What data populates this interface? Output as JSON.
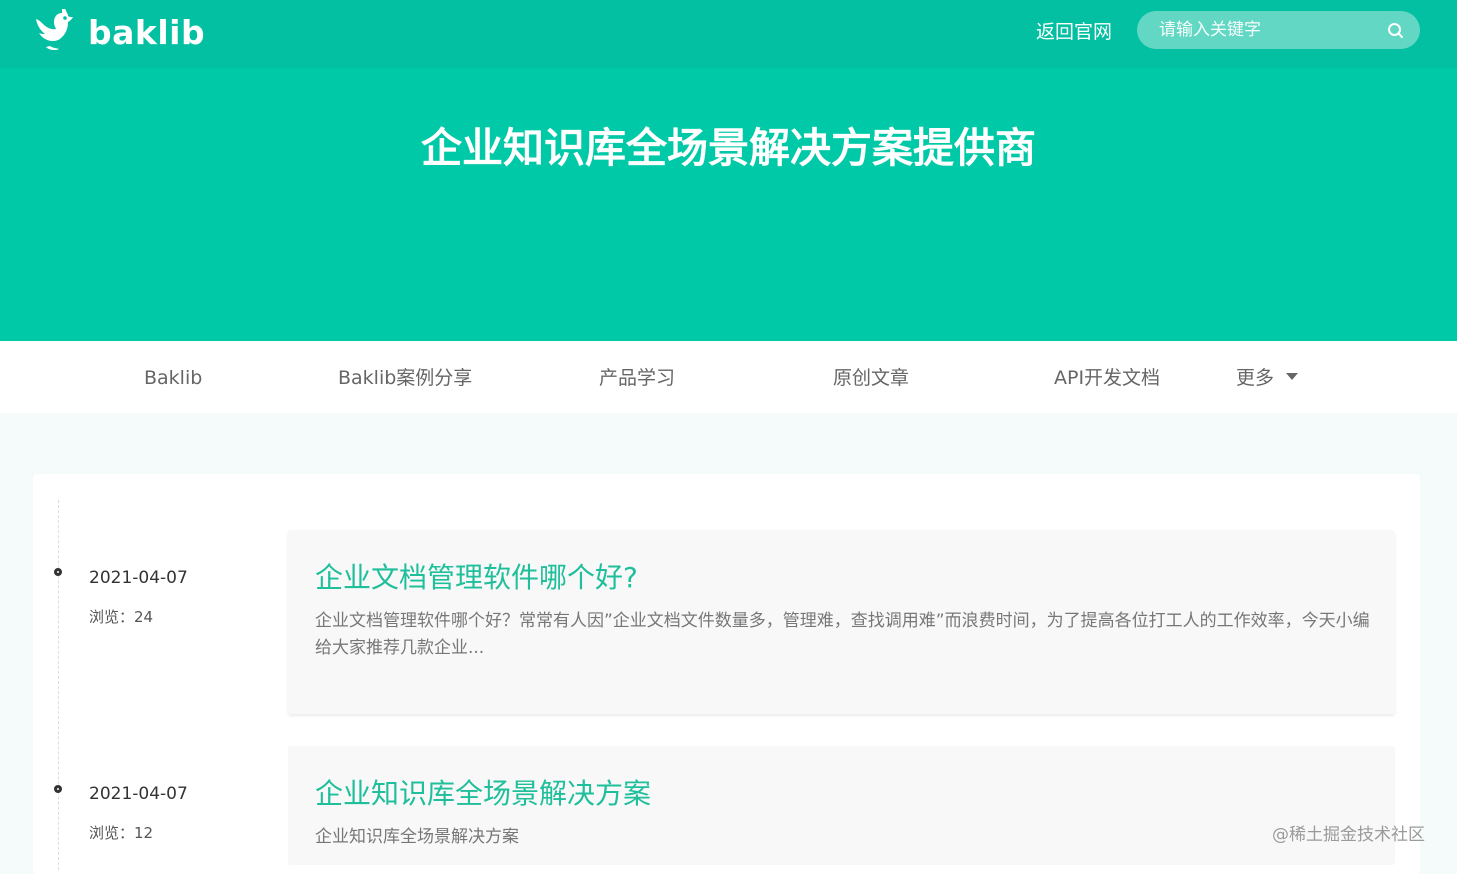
{
  "header": {
    "logo_text": "baklib",
    "back_link": "返回官网",
    "search_placeholder": "请输入关键字",
    "hero_title": "企业知识库全场景解决方案提供商"
  },
  "nav": {
    "items": [
      {
        "label": "Baklib"
      },
      {
        "label": "Baklib案例分享"
      },
      {
        "label": "产品学习"
      },
      {
        "label": "原创文章"
      },
      {
        "label": "API开发文档"
      },
      {
        "label": "更多"
      }
    ]
  },
  "articles": [
    {
      "date": "2021-04-07",
      "views": "浏览：24",
      "title": "企业文档管理软件哪个好?",
      "summary": "企业文档管理软件哪个好？常常有人因”企业文档文件数量多，管理难，查找调用难”而浪费时间，为了提高各位打工人的工作效率，今天小编给大家推荐几款企业..."
    },
    {
      "date": "2021-04-07",
      "views": "浏览：12",
      "title": "企业知识库全场景解决方案",
      "summary": "企业知识库全场景解决方案"
    }
  ],
  "watermark": "@稀土掘金技术社区",
  "colors": {
    "brand": "#00c9a7",
    "title_link": "#1fbf9c"
  },
  "icons": {
    "logo": "bird-logo-icon",
    "search": "search-icon",
    "more": "caret-down-icon"
  }
}
